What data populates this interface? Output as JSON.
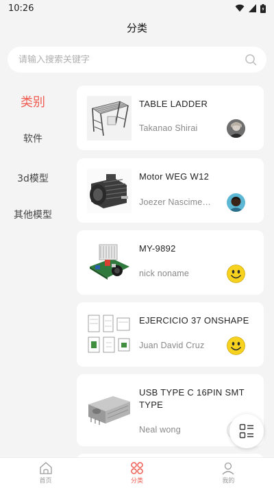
{
  "status_bar": {
    "time": "10:26"
  },
  "header": {
    "title": "分类"
  },
  "search": {
    "placeholder": "请输入搜索关键字"
  },
  "categories": [
    {
      "label": "类别",
      "active": true
    },
    {
      "label": "软件",
      "active": false
    },
    {
      "label": "3d模型",
      "active": false
    },
    {
      "label": "其他模型",
      "active": false
    }
  ],
  "cards": [
    {
      "title": "TABLE LADDER",
      "author": "Takanao Shirai",
      "thumb": "ladder",
      "avatar": "photo-gray"
    },
    {
      "title": "Motor WEG W12",
      "author": "Joezer Nascimento",
      "thumb": "motor",
      "avatar": "photo-person"
    },
    {
      "title": "MY-9892",
      "author": "nick noname",
      "thumb": "pcb",
      "avatar": "smiley"
    },
    {
      "title": "EJERCICIO 37 ONSHAPE",
      "author": "Juan David Cruz",
      "thumb": "drawing",
      "avatar": "smiley"
    },
    {
      "title": "USB TYPE C 16PIN SMT TYPE",
      "author": "Neal wong",
      "thumb": "usb",
      "avatar": "photo-white"
    }
  ],
  "bottom_nav": [
    {
      "label": "首页",
      "icon": "home-icon",
      "active": false
    },
    {
      "label": "分类",
      "icon": "category-icon",
      "active": true
    },
    {
      "label": "我的",
      "icon": "profile-icon",
      "active": false
    }
  ],
  "colors": {
    "accent": "#f05a4f",
    "background": "#f4f4f4",
    "card": "#ffffff"
  }
}
